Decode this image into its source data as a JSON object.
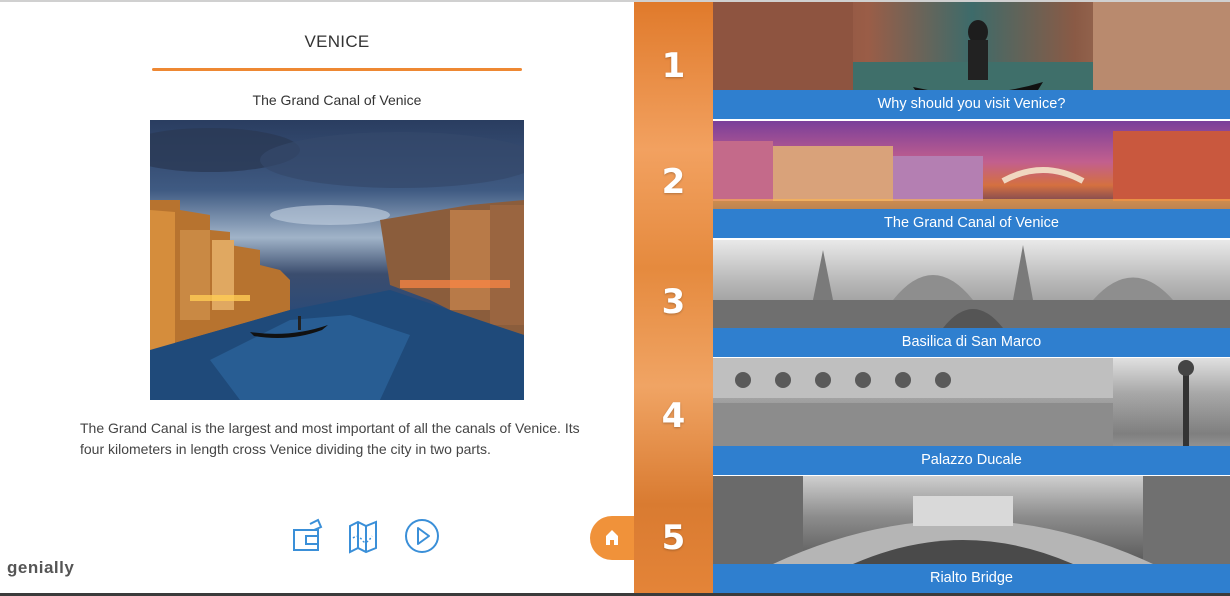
{
  "panel": {
    "title": "VENICE",
    "subtitle": "The Grand Canal of Venice",
    "description": "The Grand Canal is the largest and most important of all the canals of Venice. Its four kilometers in length cross Venice dividing the city in two parts."
  },
  "toolbar": {
    "icons": [
      "id-card-icon",
      "map-icon",
      "play-icon"
    ]
  },
  "brand": "genially",
  "menu": {
    "items": [
      {
        "number": "1",
        "label": "Why should you visit Venice?"
      },
      {
        "number": "2",
        "label": "The Grand Canal of Venice"
      },
      {
        "number": "3",
        "label": "Basilica di San Marco"
      },
      {
        "number": "4",
        "label": "Palazzo Ducale"
      },
      {
        "number": "5",
        "label": "Rialto Bridge"
      }
    ]
  },
  "colors": {
    "accent_orange": "#ee8833",
    "label_blue": "#2f7fcf"
  }
}
